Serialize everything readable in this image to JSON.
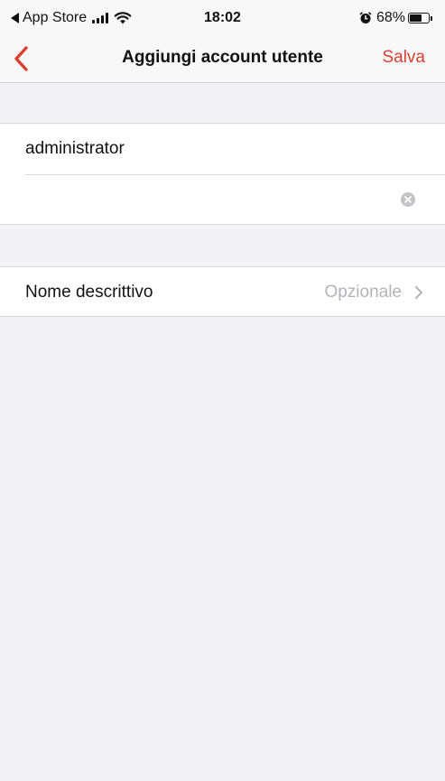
{
  "status_bar": {
    "back_app": "App Store",
    "time": "18:02",
    "battery_percent": "68%",
    "battery_level": 0.68
  },
  "nav": {
    "back_icon": "chevron-left-icon",
    "title": "Aggiungi account utente",
    "save_label": "Salva"
  },
  "account_form": {
    "username_value": "administrator",
    "password_value": ""
  },
  "friendly_name": {
    "label": "Nome descrittivo",
    "placeholder": "Opzionale"
  },
  "colors": {
    "accent": "#d9412f",
    "background": "#f2f2f7",
    "secondary_text": "#b3b3b8"
  }
}
